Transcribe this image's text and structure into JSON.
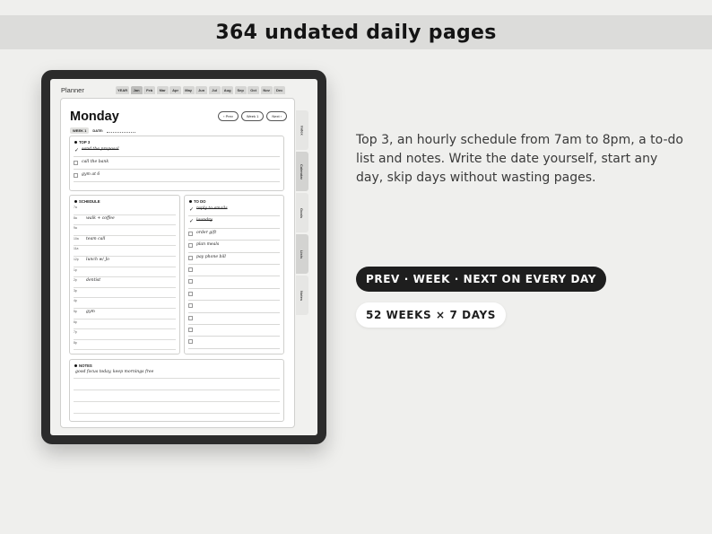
{
  "banner": {
    "title": "364 undated daily pages"
  },
  "planner": {
    "app_title": "Planner",
    "months": [
      "YEAR",
      "Jan",
      "Feb",
      "Mar",
      "Apr",
      "May",
      "Jun",
      "Jul",
      "Aug",
      "Sep",
      "Oct",
      "Nov",
      "Dec"
    ],
    "active_month": "Jan",
    "side_tabs": [
      "Index",
      "Calendar",
      "Goals",
      "Lists",
      "Notes"
    ],
    "day": "Monday",
    "nav": {
      "prev": "‹ Prev",
      "week": "Week 1",
      "next": "Next ›"
    },
    "week_badge": "WEEK 1",
    "date_label": "DATE:",
    "top3": {
      "title": "TOP 3",
      "items": [
        {
          "text": "send the proposal",
          "done": true
        },
        {
          "text": "call the bank",
          "done": false
        },
        {
          "text": "gym at 6",
          "done": false
        }
      ]
    },
    "schedule": {
      "title": "SCHEDULE",
      "rows": [
        {
          "hour": "7a",
          "text": ""
        },
        {
          "hour": "8a",
          "text": "walk + coffee"
        },
        {
          "hour": "9a",
          "text": ""
        },
        {
          "hour": "10a",
          "text": "team call"
        },
        {
          "hour": "11a",
          "text": ""
        },
        {
          "hour": "12p",
          "text": "lunch w/ Jo"
        },
        {
          "hour": "1p",
          "text": ""
        },
        {
          "hour": "2p",
          "text": "dentist"
        },
        {
          "hour": "3p",
          "text": ""
        },
        {
          "hour": "4p",
          "text": ""
        },
        {
          "hour": "5p",
          "text": "gym"
        },
        {
          "hour": "6p",
          "text": ""
        },
        {
          "hour": "7p",
          "text": ""
        },
        {
          "hour": "8p",
          "text": ""
        }
      ]
    },
    "todo": {
      "title": "TO DO",
      "items": [
        {
          "text": "reply to emails",
          "done": true
        },
        {
          "text": "laundry",
          "done": true
        },
        {
          "text": "order gift",
          "done": false
        },
        {
          "text": "plan meals",
          "done": false
        },
        {
          "text": "pay phone bill",
          "done": false
        },
        {
          "text": "",
          "done": false
        },
        {
          "text": "",
          "done": false
        },
        {
          "text": "",
          "done": false
        },
        {
          "text": "",
          "done": false
        },
        {
          "text": "",
          "done": false
        },
        {
          "text": "",
          "done": false
        },
        {
          "text": "",
          "done": false
        }
      ]
    },
    "notes": {
      "title": "NOTES",
      "lines": [
        "good focus today, keep mornings free",
        "",
        "",
        ""
      ]
    }
  },
  "description": "Top 3, an hourly schedule from 7am to 8pm, a to-do list and notes. Write the date yourself, start any day, skip days without wasting pages.",
  "pills": {
    "primary": "PREV · WEEK · NEXT ON EVERY DAY",
    "secondary": "52 WEEKS × 7 DAYS"
  },
  "colors": {
    "background": "#efefed",
    "banner": "#dcdcda",
    "tablet_frame": "#2b2b2b",
    "pill_dark": "#1e1e1e"
  }
}
